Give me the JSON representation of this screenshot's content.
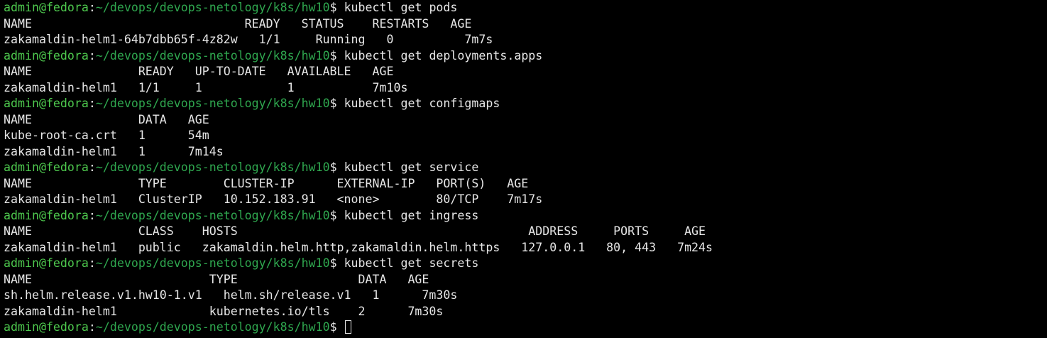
{
  "prompt": {
    "user_host": "admin@fedora",
    "separator": ":",
    "path": "~/devops/devops-netology/k8s/hw10",
    "symbol": "$ "
  },
  "lines": [
    {
      "type": "prompt",
      "command": "kubectl get pods"
    },
    {
      "type": "output",
      "text": "NAME                              READY   STATUS    RESTARTS   AGE"
    },
    {
      "type": "output",
      "text": "zakamaldin-helm1-64b7dbb65f-4z82w   1/1     Running   0          7m7s"
    },
    {
      "type": "prompt",
      "command": "kubectl get deployments.apps"
    },
    {
      "type": "output",
      "text": "NAME               READY   UP-TO-DATE   AVAILABLE   AGE"
    },
    {
      "type": "output",
      "text": "zakamaldin-helm1   1/1     1            1           7m10s"
    },
    {
      "type": "prompt",
      "command": "kubectl get configmaps"
    },
    {
      "type": "output",
      "text": "NAME               DATA   AGE"
    },
    {
      "type": "output",
      "text": "kube-root-ca.crt   1      54m"
    },
    {
      "type": "output",
      "text": "zakamaldin-helm1   1      7m14s"
    },
    {
      "type": "prompt",
      "command": "kubectl get service"
    },
    {
      "type": "output",
      "text": "NAME               TYPE        CLUSTER-IP      EXTERNAL-IP   PORT(S)   AGE"
    },
    {
      "type": "output",
      "text": "zakamaldin-helm1   ClusterIP   10.152.183.91   <none>        80/TCP    7m17s"
    },
    {
      "type": "prompt",
      "command": "kubectl get ingress"
    },
    {
      "type": "output",
      "text": "NAME               CLASS    HOSTS                                         ADDRESS     PORTS     AGE"
    },
    {
      "type": "output",
      "text": "zakamaldin-helm1   public   zakamaldin.helm.http,zakamaldin.helm.https   127.0.0.1   80, 443   7m24s"
    },
    {
      "type": "prompt",
      "command": "kubectl get secrets"
    },
    {
      "type": "output",
      "text": "NAME                         TYPE                 DATA   AGE"
    },
    {
      "type": "output",
      "text": "sh.helm.release.v1.hw10-1.v1   helm.sh/release.v1   1      7m30s"
    },
    {
      "type": "output",
      "text": "zakamaldin-helm1             kubernetes.io/tls    2      7m30s"
    },
    {
      "type": "prompt",
      "command": "",
      "cursor": true
    }
  ],
  "colors": {
    "background": "#000000",
    "text": "#e6e6e6",
    "prompt_user": "#4ec94e",
    "prompt_path": "#2fa84f"
  }
}
